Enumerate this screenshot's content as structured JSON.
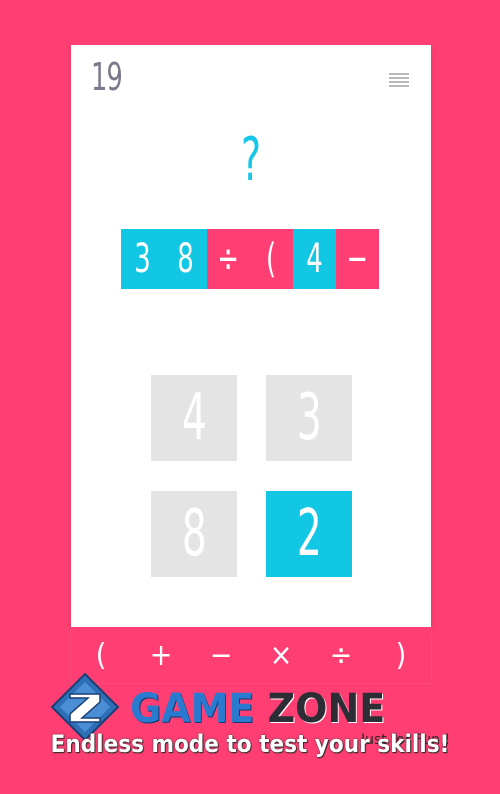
{
  "score": "19",
  "question_mark": "?",
  "expression": [
    {
      "text": "3",
      "kind": "num"
    },
    {
      "text": "8",
      "kind": "num"
    },
    {
      "text": "÷",
      "kind": "op"
    },
    {
      "text": "(",
      "kind": "op"
    },
    {
      "text": "4",
      "kind": "num"
    },
    {
      "text": "−",
      "kind": "op"
    }
  ],
  "tiles": [
    {
      "value": "4",
      "selected": false
    },
    {
      "value": "3",
      "selected": false
    },
    {
      "value": "8",
      "selected": false
    },
    {
      "value": "2",
      "selected": true
    }
  ],
  "operators": [
    "(",
    "+",
    "−",
    "×",
    "÷",
    ")"
  ],
  "logo": {
    "word1": "GAME",
    "word2": "ZONE",
    "subtitle": "Just for Fun !"
  },
  "tagline": "Endless mode to test your skills!",
  "colors": {
    "background": "#ff3f73",
    "number_tile": "#12c7e3",
    "operator_tile": "#ff3f73",
    "inactive_tile": "#e4e4e4"
  }
}
